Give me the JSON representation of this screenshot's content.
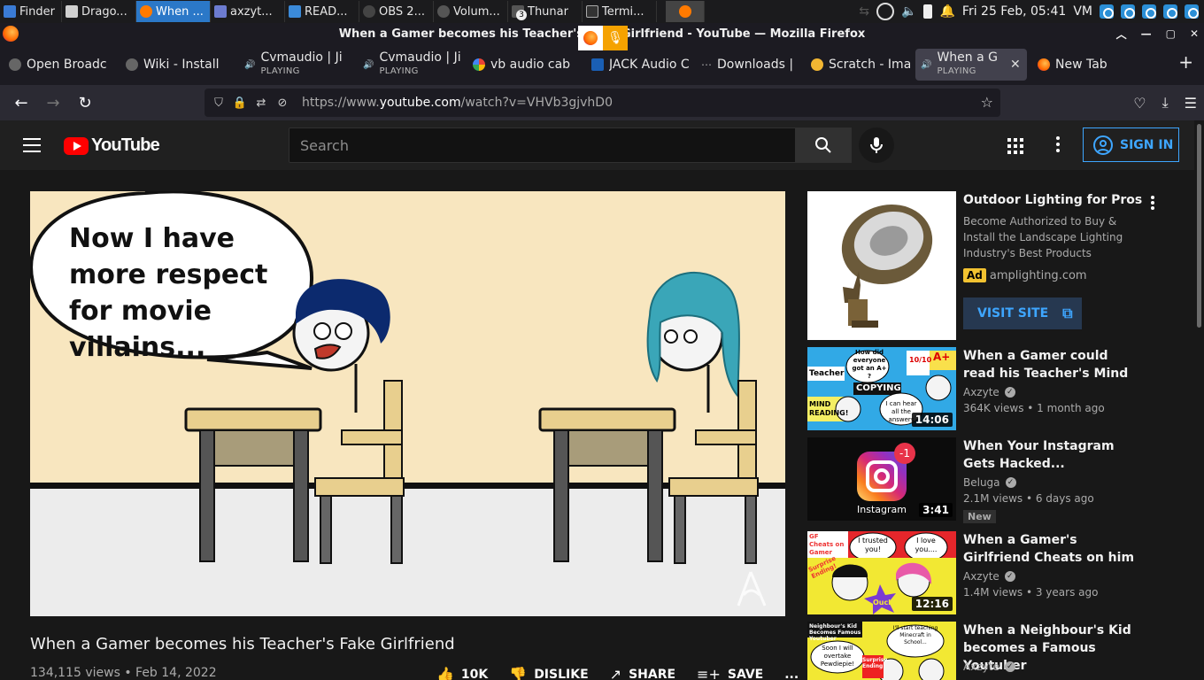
{
  "taskbar": {
    "tasks": [
      {
        "label": "Finder",
        "color": "#3a7bd5"
      },
      {
        "label": "Drago...",
        "color": "#d0d0d0"
      },
      {
        "label": "When ...",
        "color": "#ff7a00"
      },
      {
        "label": "axzyt...",
        "color": "#6c7bd0"
      },
      {
        "label": "READ...",
        "color": "#3b8ad9"
      },
      {
        "label": "OBS 2...",
        "color": "#444"
      },
      {
        "label": "Volum...",
        "color": "#555"
      },
      {
        "label": "Thunar",
        "color": "#555"
      },
      {
        "label": "Termi...",
        "color": "#333"
      }
    ],
    "badge": "3",
    "clock": "Fri 25 Feb, 05:41",
    "vm": "VM"
  },
  "window": {
    "title": "When a Gamer becomes his Teacher's Fake Girlfriend - YouTube — Mozilla Firefox"
  },
  "tabs": [
    {
      "label": "Open Broadc",
      "sub": "",
      "favicon": "#666"
    },
    {
      "label": "Wiki - Install",
      "sub": "",
      "favicon": "#666"
    },
    {
      "label": "Cvmaudio | Ji",
      "sub": "PLAYING",
      "favicon": "#d33"
    },
    {
      "label": "Cvmaudio | Ji",
      "sub": "PLAYING",
      "favicon": "#d33"
    },
    {
      "label": "vb audio cab",
      "sub": "",
      "favicon": "#4285f4"
    },
    {
      "label": "JACK Audio C",
      "sub": "",
      "favicon": "#1a5fb4"
    },
    {
      "label": "Downloads | ",
      "sub": "",
      "favicon": "#888"
    },
    {
      "label": "Scratch - Ima",
      "sub": "",
      "favicon": "#f2b632"
    },
    {
      "label": "When a G",
      "sub": "PLAYING",
      "favicon": "#ccc"
    },
    {
      "label": "New Tab",
      "sub": "",
      "favicon": "#ff7139"
    }
  ],
  "url": {
    "prefix": "https://www.",
    "domain": "youtube.com",
    "path": "/watch?v=VHVb3gjvhD0"
  },
  "youtube": {
    "logo_text": "YouTube",
    "search_placeholder": "Search",
    "sign_in": "SIGN IN",
    "video": {
      "caption": "Now I have more respect for movie villains...",
      "title": "When a Gamer becomes his Teacher's Fake Girlfriend",
      "meta": "134,115 views • Feb 14, 2022",
      "likes": "10K",
      "dislike": "DISLIKE",
      "share": "SHARE",
      "save": "SAVE",
      "more": "..."
    },
    "ad": {
      "title": "Outdoor Lighting for Pros",
      "description": "Become Authorized to Buy & Install the Landscape Lighting Industry's Best Products",
      "badge": "Ad",
      "domain": "amplighting.com",
      "cta": "VISIT SITE"
    },
    "related": [
      {
        "title": "When a Gamer could read his Teacher's Mind",
        "channel": "Axzyte",
        "stats": "364K views • 1 month ago",
        "duration": "14:06",
        "badge": "",
        "thumb_text": [
          "How did everyone got an A+ ?",
          "Teacher",
          "COPYING",
          "MIND READING!",
          "I can hear all the answers",
          "10/10",
          "A+"
        ]
      },
      {
        "title": "When Your Instagram Gets Hacked...",
        "channel": "Beluga",
        "stats": "2.1M views • 6 days ago",
        "duration": "3:41",
        "badge": "New",
        "thumb_text": [
          "Instagram",
          "-1"
        ]
      },
      {
        "title": "When a Gamer's Girlfriend Cheats on him",
        "channel": "Axzyte",
        "stats": "1.4M views • 3 years ago",
        "duration": "12:16",
        "badge": "",
        "thumb_text": [
          "GF Cheats on Gamer",
          "I trusted you!",
          "I love you....",
          "Surprise Ending!",
          "Ouch!"
        ]
      },
      {
        "title": "When a Neighbour's Kid becomes a Famous Youtuber",
        "channel": "Axzyte",
        "stats": "",
        "duration": "",
        "badge": "",
        "thumb_text": [
          "Neighbour's Kid Becomes Famous Youtuber",
          "Soon I will overtake Pewdiepie!",
          "I'll start teaching Minecraft in School...",
          "Surprise Ending!"
        ]
      }
    ]
  }
}
